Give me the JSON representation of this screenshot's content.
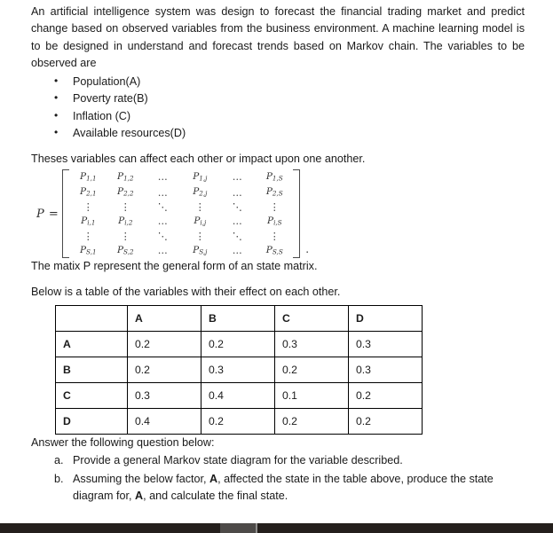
{
  "document": {
    "intro_paragraph": "An artificial intelligence system was design to forecast the financial trading market and predict change based on observed variables from the business environment. A machine learning model is to be designed in understand and forecast trends based on Markov chain. The variables to be observed are",
    "variables": [
      "Population(A)",
      "Poverty rate(B)",
      "Inflation (C)",
      "Available resources(D)"
    ],
    "affect_line": "Theses variables can affect each other or impact upon one another.",
    "matrix_caption": "The matix P represent the general form of an state matrix.",
    "table_caption": "Below is a table of the variables with their effect on each other.",
    "answer_intro": "Answer the following question below:",
    "questions": [
      {
        "marker": "a.",
        "text": "Provide a general Markov state diagram for the variable described."
      },
      {
        "marker": "b.",
        "text": "Assuming the below factor, A, affected the state in the table above, produce the state diagram for, A, and calculate the final state."
      }
    ]
  },
  "matrix": {
    "label": "P =",
    "trailing_period": ".",
    "symbol": "P",
    "row_indices": [
      "1",
      "2",
      "⋮",
      "i",
      "⋮",
      "S"
    ],
    "col_indices": [
      "1",
      "2",
      "…",
      "j",
      "…",
      "S"
    ],
    "cells": [
      [
        {
          "t": "p",
          "sub": "1,1"
        },
        {
          "t": "p",
          "sub": "1,2"
        },
        {
          "t": "h"
        },
        {
          "t": "p",
          "sub": "1,j"
        },
        {
          "t": "h"
        },
        {
          "t": "p",
          "sub": "1,S"
        }
      ],
      [
        {
          "t": "p",
          "sub": "2,1"
        },
        {
          "t": "p",
          "sub": "2,2"
        },
        {
          "t": "h"
        },
        {
          "t": "p",
          "sub": "2,j"
        },
        {
          "t": "h"
        },
        {
          "t": "p",
          "sub": "2,S"
        }
      ],
      [
        {
          "t": "v"
        },
        {
          "t": "v"
        },
        {
          "t": "d"
        },
        {
          "t": "v"
        },
        {
          "t": "d"
        },
        {
          "t": "v"
        }
      ],
      [
        {
          "t": "p",
          "sub": "i,1"
        },
        {
          "t": "p",
          "sub": "i,2"
        },
        {
          "t": "h"
        },
        {
          "t": "p",
          "sub": "i,j"
        },
        {
          "t": "h"
        },
        {
          "t": "p",
          "sub": "i,S"
        }
      ],
      [
        {
          "t": "v"
        },
        {
          "t": "v"
        },
        {
          "t": "d"
        },
        {
          "t": "v"
        },
        {
          "t": "d"
        },
        {
          "t": "v"
        }
      ],
      [
        {
          "t": "p",
          "sub": "S,1"
        },
        {
          "t": "p",
          "sub": "S,2"
        },
        {
          "t": "h"
        },
        {
          "t": "p",
          "sub": "S,j"
        },
        {
          "t": "h"
        },
        {
          "t": "p",
          "sub": "S,S"
        }
      ]
    ],
    "glyphs": {
      "hdots": "…",
      "vdots": "⋮",
      "ddots": "⋱"
    }
  },
  "effects_table": {
    "columns": [
      "",
      "A",
      "B",
      "C",
      "D"
    ],
    "rows": [
      {
        "label": "A",
        "values": [
          "0.2",
          "0.2",
          "0.3",
          "0.3"
        ]
      },
      {
        "label": "B",
        "values": [
          "0.2",
          "0.3",
          "0.2",
          "0.3"
        ]
      },
      {
        "label": "C",
        "values": [
          "0.3",
          "0.4",
          "0.1",
          "0.2"
        ]
      },
      {
        "label": "D",
        "values": [
          "0.4",
          "0.2",
          "0.2",
          "0.2"
        ]
      }
    ]
  },
  "scrollbar": {
    "orientation": "horizontal",
    "track_color": "#241f1c",
    "thumb_color": "#4d4a48"
  }
}
